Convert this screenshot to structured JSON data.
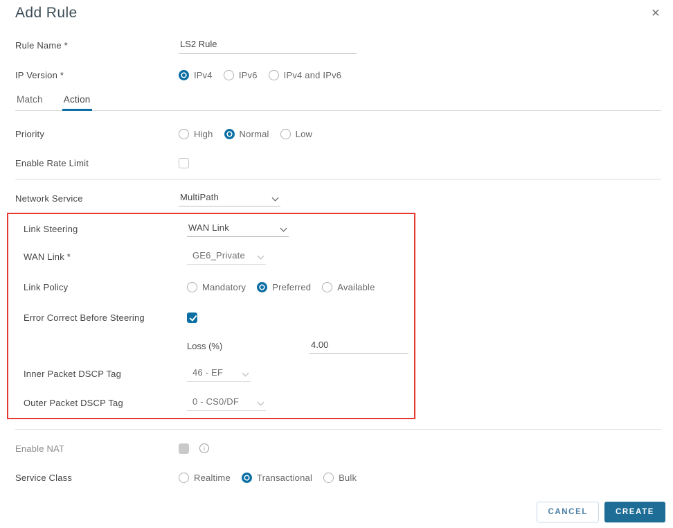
{
  "colors": {
    "accent_blue": "#0b6fa4",
    "create_button_bg": "#1d6d96",
    "cancel_text": "#4a7fa5",
    "highlight_red": "#e63a30",
    "label_text": "#454545",
    "muted_text": "#666666",
    "disabled_text": "#8c8c8c",
    "underline": "#c4c4c4",
    "divider": "#dcdcdc",
    "title_text": "#3c4c56"
  },
  "dialog": {
    "title": "Add Rule"
  },
  "icons": {
    "close": "✕",
    "info": "i"
  },
  "tabs": {
    "items": [
      {
        "label": "Match",
        "active": false
      },
      {
        "label": "Action",
        "active": true
      }
    ]
  },
  "form": {
    "rule_name": {
      "label": "Rule Name *",
      "value": "LS2 Rule"
    },
    "ip_version": {
      "label": "IP Version *",
      "selected": "IPv4",
      "options": [
        {
          "label": "IPv4",
          "selected": true
        },
        {
          "label": "IPv6",
          "selected": false
        },
        {
          "label": "IPv4 and IPv6",
          "selected": false
        }
      ]
    },
    "priority": {
      "label": "Priority",
      "selected": "Normal",
      "options": [
        {
          "label": "High",
          "selected": false
        },
        {
          "label": "Normal",
          "selected": true
        },
        {
          "label": "Low",
          "selected": false
        }
      ]
    },
    "enable_rate_limit": {
      "label": "Enable Rate Limit",
      "checked": false
    },
    "network_service": {
      "label": "Network Service",
      "value": "MultiPath"
    },
    "link_steering": {
      "label": "Link Steering",
      "value": "WAN Link"
    },
    "wan_link": {
      "label": "WAN Link *",
      "value": "GE6_Private"
    },
    "link_policy": {
      "label": "Link Policy",
      "selected": "Preferred",
      "options": [
        {
          "label": "Mandatory",
          "selected": false
        },
        {
          "label": "Preferred",
          "selected": true
        },
        {
          "label": "Available",
          "selected": false
        }
      ]
    },
    "error_correct_before_steering": {
      "label": "Error Correct Before Steering",
      "checked": true
    },
    "loss": {
      "label": "Loss (%)",
      "value": "4.00"
    },
    "inner_packet_dscp_tag": {
      "label": "Inner Packet DSCP Tag",
      "value": "46 - EF"
    },
    "outer_packet_dscp_tag": {
      "label": "Outer Packet DSCP Tag",
      "value": "0 - CS0/DF"
    },
    "enable_nat": {
      "label": "Enable NAT",
      "checked": false,
      "disabled": true
    },
    "service_class": {
      "label": "Service Class",
      "selected": "Transactional",
      "options": [
        {
          "label": "Realtime",
          "selected": false
        },
        {
          "label": "Transactional",
          "selected": true
        },
        {
          "label": "Bulk",
          "selected": false
        }
      ]
    }
  },
  "footer": {
    "cancel_label": "CANCEL",
    "create_label": "CREATE"
  }
}
